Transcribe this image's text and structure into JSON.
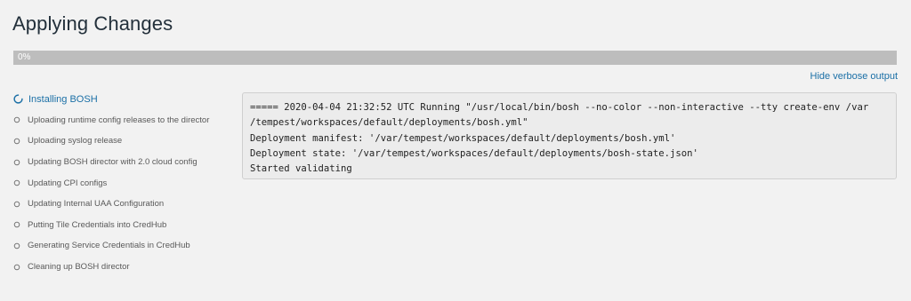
{
  "page": {
    "title": "Applying Changes"
  },
  "progress": {
    "percent_text": "0%",
    "value": 0,
    "track_color": "#bdbdbd",
    "fill_color": "#1f7fb0"
  },
  "verbose_link": {
    "label": "Hide verbose output",
    "color": "#1a6fa6"
  },
  "steps": [
    {
      "label": "Installing BOSH",
      "status": "in-progress",
      "icon": "spinner-icon"
    },
    {
      "label": "Uploading runtime config releases to the director",
      "status": "pending",
      "icon": "circle-icon"
    },
    {
      "label": "Uploading syslog release",
      "status": "pending",
      "icon": "circle-icon"
    },
    {
      "label": "Updating BOSH director with 2.0 cloud config",
      "status": "pending",
      "icon": "circle-icon"
    },
    {
      "label": "Updating CPI configs",
      "status": "pending",
      "icon": "circle-icon"
    },
    {
      "label": "Updating Internal UAA Configuration",
      "status": "pending",
      "icon": "circle-icon"
    },
    {
      "label": "Putting Tile Credentials into CredHub",
      "status": "pending",
      "icon": "circle-icon"
    },
    {
      "label": "Generating Service Credentials in CredHub",
      "status": "pending",
      "icon": "circle-icon"
    },
    {
      "label": "Cleaning up BOSH director",
      "status": "pending",
      "icon": "circle-icon"
    }
  ],
  "log": {
    "lines": [
      "===== 2020-04-04 21:32:52 UTC Running \"/usr/local/bin/bosh --no-color --non-interactive --tty create-env /var",
      "/tempest/workspaces/default/deployments/bosh.yml\"",
      "Deployment manifest: '/var/tempest/workspaces/default/deployments/bosh.yml'",
      "Deployment state: '/var/tempest/workspaces/default/deployments/bosh-state.json'",
      "Started validating"
    ]
  }
}
